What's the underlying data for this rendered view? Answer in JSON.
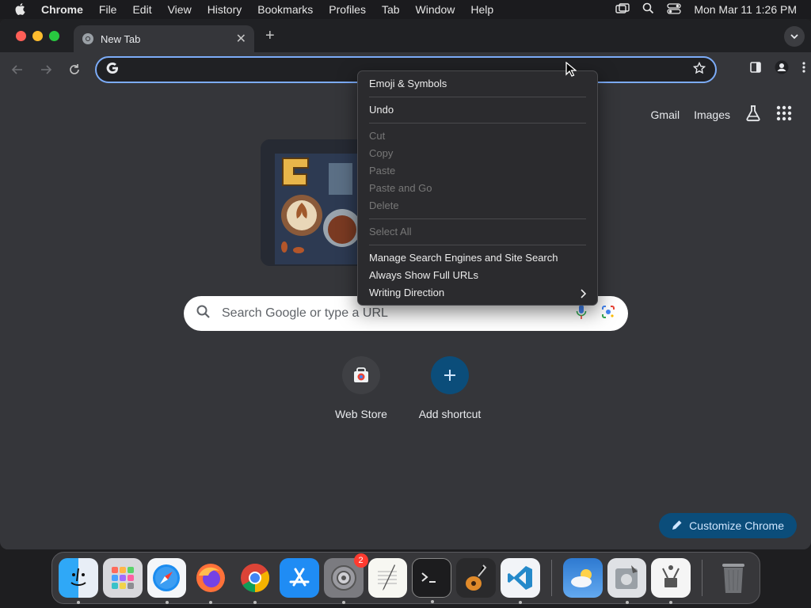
{
  "menubar": {
    "app_name": "Chrome",
    "items": [
      "File",
      "Edit",
      "View",
      "History",
      "Bookmarks",
      "Profiles",
      "Tab",
      "Window",
      "Help"
    ],
    "clock": "Mon Mar 11  1:26 PM"
  },
  "tabs": [
    {
      "title": "New Tab"
    }
  ],
  "omnibox": {
    "value": "",
    "placeholder": ""
  },
  "ntp": {
    "links": {
      "gmail": "Gmail",
      "images": "Images"
    },
    "search_placeholder": "Search Google or type a URL",
    "shortcuts": [
      {
        "label": "Web Store"
      },
      {
        "label": "Add shortcut"
      }
    ],
    "customize_label": "Customize Chrome"
  },
  "context_menu": {
    "items": [
      {
        "label": "Emoji & Symbols",
        "enabled": true
      },
      {
        "label": "Undo",
        "enabled": true
      },
      {
        "label": "Cut",
        "enabled": false
      },
      {
        "label": "Copy",
        "enabled": false
      },
      {
        "label": "Paste",
        "enabled": false
      },
      {
        "label": "Paste and Go",
        "enabled": false
      },
      {
        "label": "Delete",
        "enabled": false
      },
      {
        "label": "Select All",
        "enabled": false
      },
      {
        "label": "Manage Search Engines and Site Search",
        "enabled": true
      },
      {
        "label": "Always Show Full URLs",
        "enabled": true
      },
      {
        "label": "Writing Direction",
        "enabled": true,
        "submenu": true
      }
    ]
  },
  "dock": {
    "apps": [
      {
        "icon": "finder-icon"
      },
      {
        "icon": "launchpad-icon"
      },
      {
        "icon": "safari-icon"
      },
      {
        "icon": "firefox-icon"
      },
      {
        "icon": "chrome-icon"
      },
      {
        "icon": "app-store-icon"
      },
      {
        "icon": "system-settings-icon",
        "badge": "2"
      },
      {
        "icon": "textedit-icon"
      },
      {
        "icon": "terminal-icon"
      },
      {
        "icon": "garageband-icon"
      },
      {
        "icon": "vscode-icon"
      },
      {
        "icon": "weather-icon"
      },
      {
        "icon": "disk-utility-icon"
      },
      {
        "icon": "system-info-icon"
      },
      {
        "icon": "trash-icon"
      }
    ]
  },
  "colors": {
    "accent": "#7cacf8",
    "frame": "#202124",
    "surface": "#35363a",
    "customize_bg": "#0b4d7a"
  }
}
